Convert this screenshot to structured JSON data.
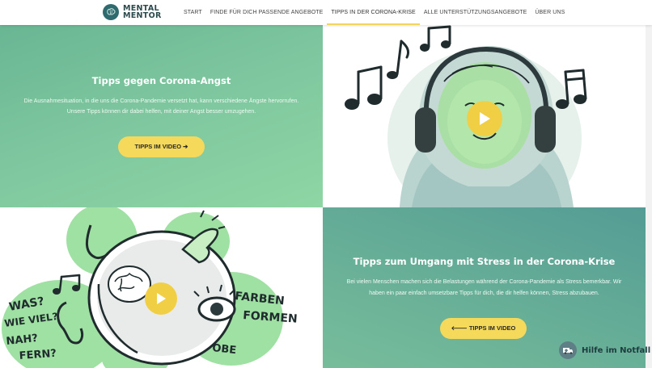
{
  "brand": {
    "line1": "MENTAL",
    "line2": "MENTOR"
  },
  "nav": [
    {
      "label": "START"
    },
    {
      "label": "FINDE FÜR DICH PASSENDE ANGEBOTE"
    },
    {
      "label": "TIPPS IN DER CORONA-KRISE",
      "active": true
    },
    {
      "label": "ALLE UNTERSTÜTZUNGSANGEBOTE"
    },
    {
      "label": "ÜBER UNS"
    }
  ],
  "section1": {
    "title": "Tipps gegen Corona-Angst",
    "text_line1": "Die Ausnahmesituation, in die uns die Corona-Pandemie versetzt hat, kann verschiedene Ängste hervorrufen.",
    "text_line2": "Unsere Tipps können dir dabei helfen, mit deiner Angst besser umzugehen.",
    "button": "TIPPS IM VIDEO ➔"
  },
  "section2": {
    "title": "Tipps zum Umgang mit Stress in der Corona-Krise",
    "text_line1": "Bei vielen Menschen machen sich die Belastungen während der Corona-Pandemie als Stress bemerkbar. Wir",
    "text_line2": "haben ein paar einfach umsetzbare Tipps für dich, die dir helfen können, Stress abzubauen.",
    "button": "🡐 TIPPS IM VIDEO"
  },
  "illustration2": {
    "words_left1": "WAS?",
    "words_left2": "WIE VIEL?",
    "words_left3": "NAH?",
    "words_left4": "FERN?",
    "words_right1": "FARBEN",
    "words_right2": "FORMEN",
    "words_bottom": "OBE"
  },
  "help": {
    "label": "Hilfe im Notfall"
  },
  "colors": {
    "accent": "#f5d95b",
    "green_light": "#8fd6a4",
    "green_dark": "#549c95"
  },
  "icons": {
    "logo": "brain-logo-icon",
    "play": "play-icon",
    "help": "ambulance-icon"
  }
}
